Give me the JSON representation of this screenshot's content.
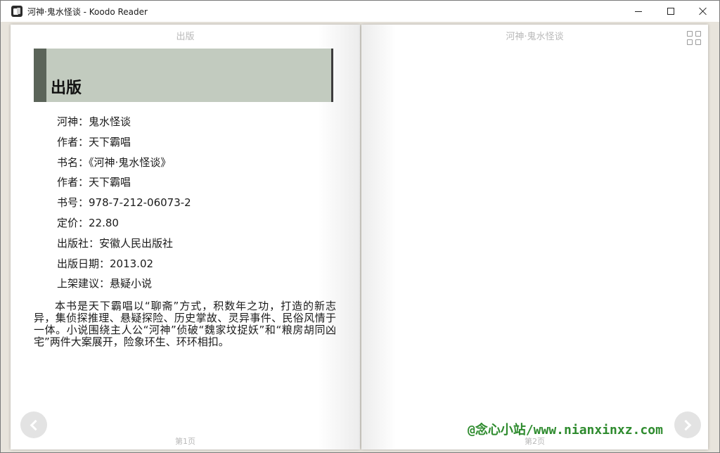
{
  "window": {
    "title": "河神·鬼水怪谈 - Koodo Reader",
    "app_icon": "koodo-reader-icon",
    "controls": [
      "minimize-icon",
      "maximize-icon",
      "close-icon"
    ]
  },
  "reader": {
    "left_page": {
      "header": "出版",
      "chapter_title": "出版",
      "lines": [
        "河神：鬼水怪谈",
        "作者：天下霸唱",
        "书名：《河神·鬼水怪谈》",
        "作者：天下霸唱",
        "书号：978-7-212-06073-2",
        "定价：22.80",
        "出版社：安徽人民出版社",
        "出版日期：2013.02",
        "上架建议：悬疑小说"
      ],
      "summary": "本书是天下霸唱以“聊斋”方式，积数年之功，打造的新志异，集侦探推理、悬疑探险、历史掌故、灵异事件、民俗风情于一体。小说围绕主人公“河神”侦破“魏家坟捉妖”和“粮房胡同凶宅”两件大案展开，险象环生、环环相扣。",
      "footer": "第1页"
    },
    "right_page": {
      "header": "河神·鬼水怪谈",
      "footer": "第2页"
    },
    "nav": {
      "prev_icon": "chevron-left-icon",
      "next_icon": "chevron-right-icon"
    },
    "menu_icon": "grid-icon"
  },
  "watermark": "@念心小站/www.nianxinxz.com"
}
